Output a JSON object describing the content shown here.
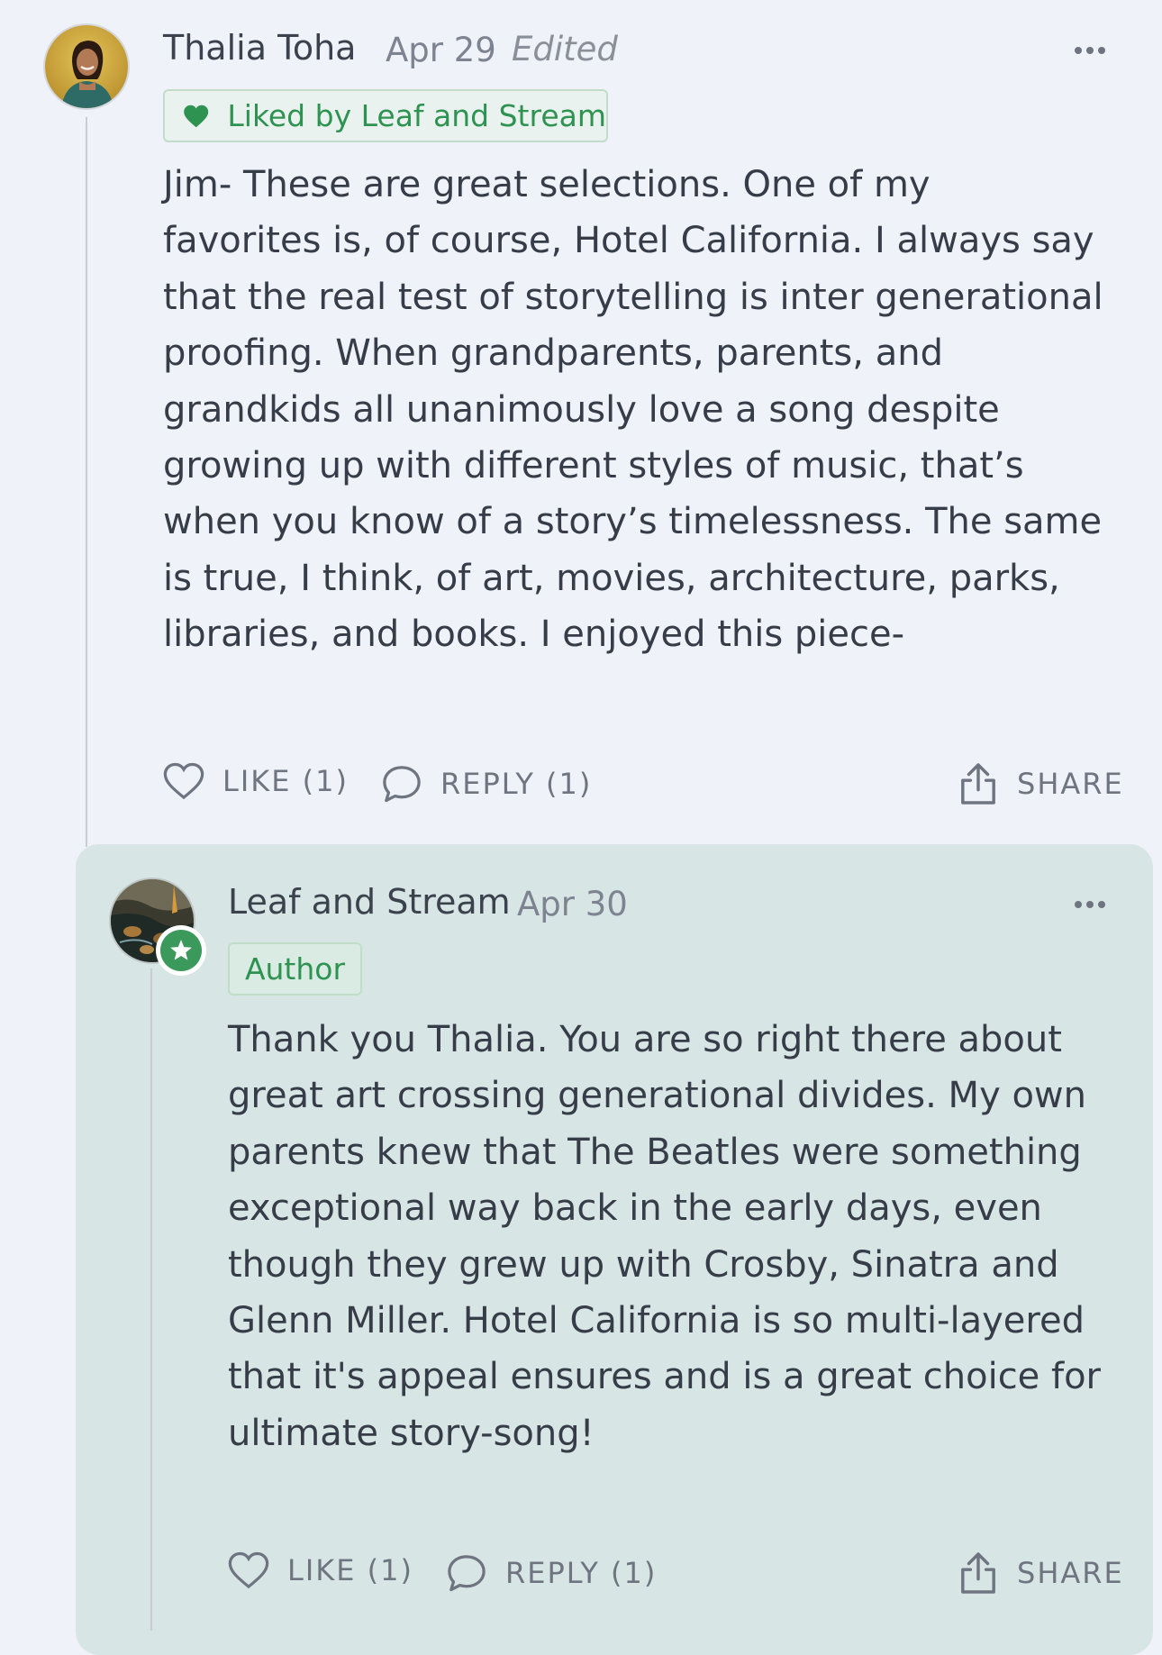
{
  "colors": {
    "page_background": "#eff2f8",
    "reply_background": "#d7e6e5",
    "accent_green": "#2e9350",
    "text": "#363c48",
    "muted": "#7d8390"
  },
  "comment": {
    "author": "Thalia Toha",
    "date": "Apr 29",
    "edited": "Edited",
    "liked_badge": "Liked by Leaf and Stream",
    "body_lines": [
      "Jim- These are great selections. One of my",
      "favorites is, of course, Hotel California. I always say",
      "that the real test of storytelling is inter generational",
      "proofing. When grandparents, parents, and",
      "grandkids all unanimously love a song despite",
      "growing up with different styles of music, that’s",
      "when you know of a story’s timelessness. The same",
      "is true, I think, of art, movies, architecture, parks,",
      "libraries, and books. I enjoyed this piece-"
    ],
    "actions": {
      "like": "LIKE (1)",
      "reply": "REPLY (1)",
      "share": "SHARE"
    },
    "icons": [
      "heart-icon",
      "speech-bubble-icon",
      "share-icon",
      "more-options-icon"
    ]
  },
  "reply": {
    "author": "Leaf and Stream",
    "date": "Apr 30",
    "badge": "Author",
    "body_lines": [
      "Thank you Thalia. You are so right there about",
      "great art crossing generational divides. My own",
      "parents knew that The Beatles were something",
      "exceptional way back in the early days, even",
      "though they grew up with Crosby, Sinatra and",
      "Glenn Miller. Hotel California is so multi-layered",
      "that it's appeal ensures and is a great choice for",
      "ultimate story-song!"
    ],
    "actions": {
      "like": "LIKE (1)",
      "reply": "REPLY (1)",
      "share": "SHARE"
    },
    "icons": [
      "heart-icon",
      "speech-bubble-icon",
      "share-icon",
      "more-options-icon",
      "star-badge-icon"
    ]
  }
}
